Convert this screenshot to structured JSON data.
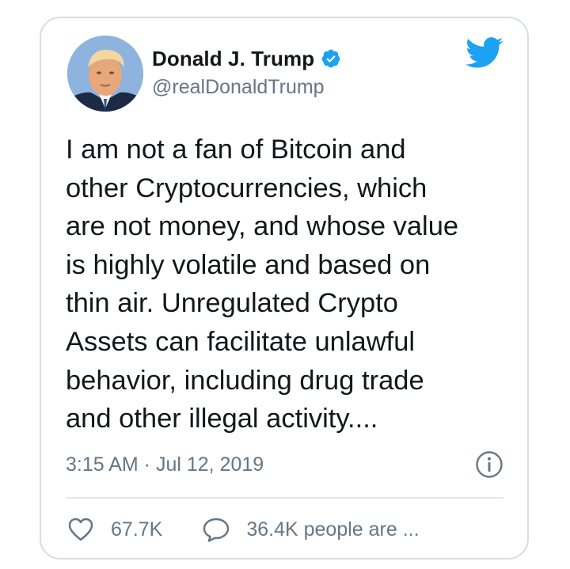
{
  "author": {
    "display_name": "Donald J. Trump",
    "handle": "@realDonaldTrump",
    "verified": true,
    "avatar_icon": "profile-photo"
  },
  "platform_icon": "twitter-bird-icon",
  "tweet": {
    "text": "I am not a fan of Bitcoin and\nother Cryptocurrencies, which\nare not money, and whose value\nis highly volatile and based on\nthin air. Unregulated Crypto\nAssets can facilitate unlawful\nbehavior, including drug trade\nand other illegal activity....",
    "timestamp": "3:15 AM · Jul 12, 2019"
  },
  "actions": {
    "likes": "67.7K",
    "replies": "36.4K people are ..."
  },
  "colors": {
    "brand": "#1da1f2",
    "text": "#14171a",
    "muted": "#657786",
    "border": "#d7dde2"
  }
}
